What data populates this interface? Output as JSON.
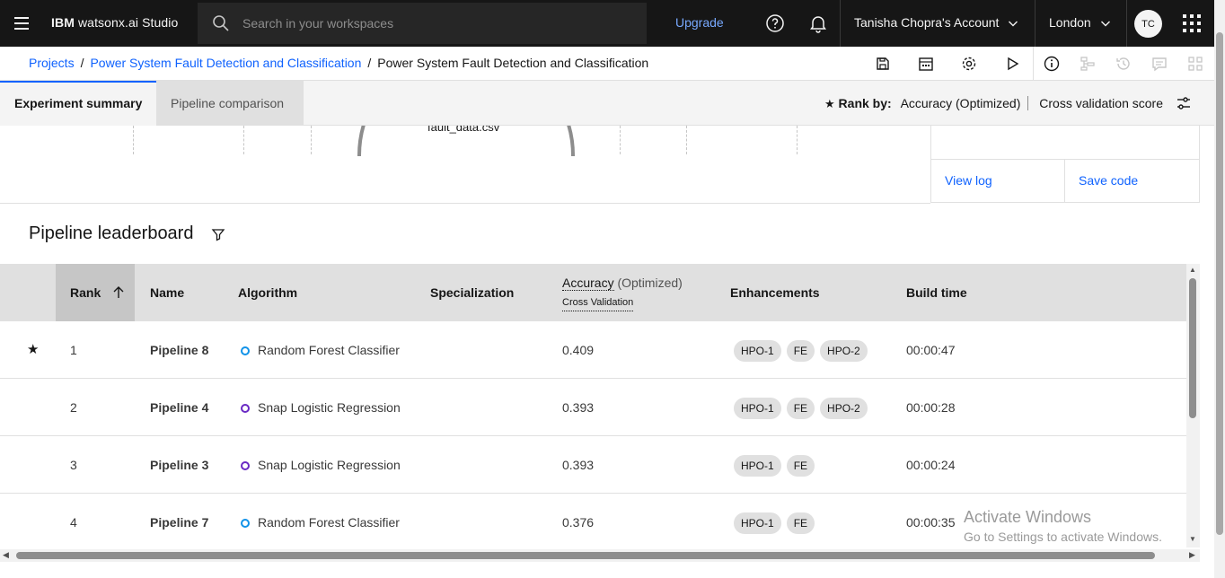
{
  "app": {
    "brand_bold": "IBM",
    "brand_rest": "watsonx.ai Studio",
    "search_placeholder": "Search in your workspaces",
    "upgrade_label": "Upgrade",
    "account_label": "Tanisha Chopra's Account",
    "region_label": "London",
    "avatar_initials": "TC"
  },
  "breadcrumb": {
    "items": [
      "Projects",
      "Power System Fault Detection and Classification"
    ],
    "current": "Power System Fault Detection and Classification"
  },
  "tabs": [
    {
      "label": "Experiment summary",
      "active": true
    },
    {
      "label": "Pipeline comparison",
      "active": false
    }
  ],
  "rank_by": {
    "star": "★",
    "label": "Rank by:",
    "selected": "Accuracy (Optimized)",
    "metric": "Cross validation score"
  },
  "visualization": {
    "node_label": "fault_data.csv"
  },
  "side_panel": {
    "view_log": "View log",
    "save_code": "Save code"
  },
  "leaderboard": {
    "title": "Pipeline leaderboard",
    "columns": {
      "rank": "Rank",
      "name": "Name",
      "algorithm": "Algorithm",
      "specialization": "Specialization",
      "accuracy": "Accuracy",
      "accuracy_suffix": "(Optimized)",
      "accuracy_sub": "Cross Validation",
      "enhancements": "Enhancements",
      "build_time": "Build time"
    },
    "rows": [
      {
        "star": "★",
        "rank": "1",
        "name": "Pipeline 8",
        "algorithm": "Random Forest Classifier",
        "algo_color": "#1192e8",
        "accuracy": "0.409",
        "tags": [
          "HPO-1",
          "FE",
          "HPO-2"
        ],
        "build_time": "00:00:47"
      },
      {
        "star": "",
        "rank": "2",
        "name": "Pipeline 4",
        "algorithm": "Snap Logistic Regression",
        "algo_color": "#6929c4",
        "accuracy": "0.393",
        "tags": [
          "HPO-1",
          "FE",
          "HPO-2"
        ],
        "build_time": "00:00:28"
      },
      {
        "star": "",
        "rank": "3",
        "name": "Pipeline 3",
        "algorithm": "Snap Logistic Regression",
        "algo_color": "#6929c4",
        "accuracy": "0.393",
        "tags": [
          "HPO-1",
          "FE"
        ],
        "build_time": "00:00:24"
      },
      {
        "star": "",
        "rank": "4",
        "name": "Pipeline 7",
        "algorithm": "Random Forest Classifier",
        "algo_color": "#1192e8",
        "accuracy": "0.376",
        "tags": [
          "HPO-1",
          "FE"
        ],
        "build_time": "00:00:35"
      }
    ]
  },
  "watermark": {
    "line1": "Activate Windows",
    "line2": "Go to Settings to activate Windows."
  },
  "colors": {
    "topbar_bg": "#161616",
    "link_blue": "#0f62fe",
    "upgrade_blue": "#78a9ff"
  }
}
